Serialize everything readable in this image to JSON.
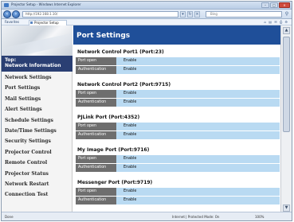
{
  "browser": {
    "title": "Projector Setup - Windows Internet Explorer",
    "url": "http://192.168.1.10/",
    "search_placeholder": "Bing",
    "favorites_label": "Favorites",
    "tab_label": "Projector Setup",
    "status_text": "Done",
    "zone_text": "Internet | Protected Mode: On",
    "zoom_text": "100%"
  },
  "sidebar": {
    "top_item": "Top:\nNetwork Information",
    "items": [
      {
        "label": "Network Settings"
      },
      {
        "label": "Port Settings"
      },
      {
        "label": "Mail Settings"
      },
      {
        "label": "Alert Settings"
      },
      {
        "label": "Schedule Settings"
      },
      {
        "label": "Date/Time Settings"
      },
      {
        "label": "Security Settings"
      },
      {
        "label": "Projector Control"
      },
      {
        "label": "Remote Control"
      },
      {
        "label": "Projector Status"
      },
      {
        "label": "Network Restart"
      },
      {
        "label": "Connection Test"
      }
    ]
  },
  "page": {
    "title": "Port Settings",
    "sections": [
      {
        "title": "Network Control Port1 (Port:23)",
        "rows": [
          {
            "label": "Port open",
            "value": "Enable"
          },
          {
            "label": "Authentication",
            "value": "Enable"
          }
        ]
      },
      {
        "title": "Network Control Port2 (Port:9715)",
        "rows": [
          {
            "label": "Port open",
            "value": "Enable"
          },
          {
            "label": "Authentication",
            "value": "Enable"
          }
        ]
      },
      {
        "title": "PJLink Port (Port:4352)",
        "rows": [
          {
            "label": "Port open",
            "value": "Enable"
          },
          {
            "label": "Authentication",
            "value": "Enable"
          }
        ]
      },
      {
        "title": "My Image Port (Port:9716)",
        "rows": [
          {
            "label": "Port open",
            "value": "Enable"
          },
          {
            "label": "Authentication",
            "value": "Enable"
          }
        ]
      },
      {
        "title": "Messenger Port (Port:9719)",
        "rows": [
          {
            "label": "Port open",
            "value": "Enable"
          },
          {
            "label": "Authentication",
            "value": "Enable"
          }
        ]
      }
    ]
  },
  "colors": {
    "header_blue": "#1f4f99",
    "sidebar_top": "#2a3f73",
    "row_label_gray": "#6e6e6e",
    "row_value_blue": "#b9daf2"
  }
}
